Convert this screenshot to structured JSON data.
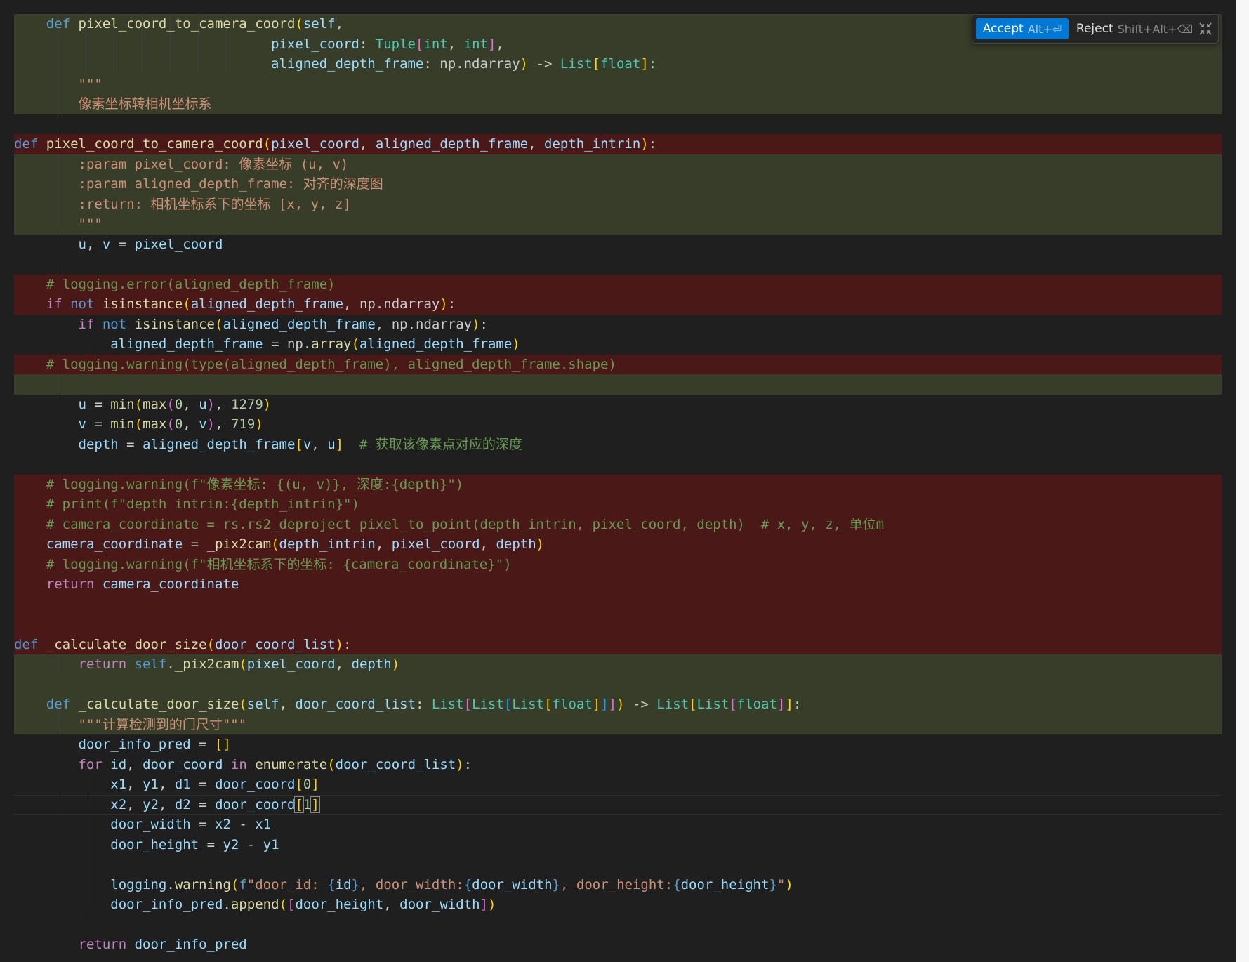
{
  "diff_widget": {
    "accept_label": "Accept",
    "accept_shortcut": "Alt+⏎",
    "reject_label": "Reject",
    "reject_shortcut": "Shift+Alt+⌫",
    "collapse_icon": "collapse-icon"
  },
  "lines": [
    {
      "bg": "added",
      "indent": 4,
      "guides": [
        4,
        8,
        12,
        16,
        20,
        24,
        28
      ],
      "tokens": [
        [
          "kw",
          "def "
        ],
        [
          "fn",
          "pixel_coord_to_camera_coord"
        ],
        [
          "br1",
          "("
        ],
        [
          "var",
          "self"
        ],
        [
          "plain",
          ","
        ]
      ]
    },
    {
      "bg": "added",
      "indent": 32,
      "guides": [
        4,
        8,
        12,
        16,
        20,
        24,
        28
      ],
      "tokens": [
        [
          "var",
          "pixel_coord"
        ],
        [
          "plain",
          ": "
        ],
        [
          "cls",
          "Tuple"
        ],
        [
          "br2",
          "["
        ],
        [
          "cls",
          "int"
        ],
        [
          "plain",
          ", "
        ],
        [
          "cls",
          "int"
        ],
        [
          "br2",
          "]"
        ],
        [
          "plain",
          ","
        ]
      ]
    },
    {
      "bg": "added",
      "indent": 32,
      "guides": [
        4,
        8,
        12,
        16,
        20,
        24,
        28
      ],
      "tokens": [
        [
          "var",
          "aligned_depth_frame"
        ],
        [
          "plain",
          ": "
        ],
        [
          "plain",
          "np.ndarray"
        ],
        [
          "br1",
          ")"
        ],
        [
          "plain",
          " -> "
        ],
        [
          "cls",
          "List"
        ],
        [
          "br1",
          "["
        ],
        [
          "cls",
          "float"
        ],
        [
          "br1",
          "]"
        ],
        [
          "plain",
          ":"
        ]
      ]
    },
    {
      "bg": "added",
      "indent": 8,
      "guides": [
        4
      ],
      "tokens": [
        [
          "str",
          "\"\"\""
        ]
      ]
    },
    {
      "bg": "added",
      "indent": 8,
      "guides": [
        4
      ],
      "tokens": [
        [
          "str",
          "像素坐标转相机坐标系"
        ]
      ]
    },
    {
      "bg": "none",
      "indent": 0,
      "guides": [
        4
      ],
      "tokens": []
    },
    {
      "bg": "removed",
      "indent": 0,
      "guides": [],
      "tokens": [
        [
          "kw",
          "def "
        ],
        [
          "fn",
          "pixel_coord_to_camera_coord"
        ],
        [
          "br1",
          "("
        ],
        [
          "var",
          "pixel_coord"
        ],
        [
          "plain",
          ", "
        ],
        [
          "var",
          "aligned_depth_frame"
        ],
        [
          "plain",
          ", "
        ],
        [
          "var",
          "depth_intrin"
        ],
        [
          "br1",
          ")"
        ],
        [
          "plain",
          ":"
        ]
      ]
    },
    {
      "bg": "added",
      "indent": 8,
      "guides": [
        4
      ],
      "tokens": [
        [
          "str",
          ":param pixel_coord: 像素坐标 (u, v)"
        ]
      ]
    },
    {
      "bg": "added",
      "indent": 8,
      "guides": [
        4
      ],
      "tokens": [
        [
          "str",
          ":param aligned_depth_frame: 对齐的深度图"
        ]
      ]
    },
    {
      "bg": "added",
      "indent": 8,
      "guides": [
        4
      ],
      "tokens": [
        [
          "str",
          ":return: 相机坐标系下的坐标 [x, y, z]"
        ]
      ]
    },
    {
      "bg": "added",
      "indent": 8,
      "guides": [
        4
      ],
      "tokens": [
        [
          "str",
          "\"\"\""
        ]
      ]
    },
    {
      "bg": "none",
      "indent": 8,
      "guides": [
        4
      ],
      "tokens": [
        [
          "var",
          "u"
        ],
        [
          "plain",
          ", "
        ],
        [
          "var",
          "v"
        ],
        [
          "plain",
          " = "
        ],
        [
          "var",
          "pixel_coord"
        ]
      ]
    },
    {
      "bg": "none",
      "indent": 0,
      "guides": [
        4
      ],
      "tokens": []
    },
    {
      "bg": "removed",
      "indent": 4,
      "guides": [],
      "tokens": [
        [
          "cm",
          "# logging.error(aligned_depth_frame)"
        ]
      ]
    },
    {
      "bg": "removed",
      "indent": 4,
      "guides": [],
      "tokens": [
        [
          "ctl",
          "if "
        ],
        [
          "kw",
          "not "
        ],
        [
          "fn",
          "isinstance"
        ],
        [
          "br1",
          "("
        ],
        [
          "var",
          "aligned_depth_frame"
        ],
        [
          "plain",
          ", "
        ],
        [
          "plain",
          "np.ndarray"
        ],
        [
          "br1",
          ")"
        ],
        [
          "plain",
          ":"
        ]
      ]
    },
    {
      "bg": "none",
      "indent": 8,
      "guides": [
        4
      ],
      "tokens": [
        [
          "ctl",
          "if "
        ],
        [
          "kw",
          "not "
        ],
        [
          "fn",
          "isinstance"
        ],
        [
          "br1",
          "("
        ],
        [
          "var",
          "aligned_depth_frame"
        ],
        [
          "plain",
          ", "
        ],
        [
          "plain",
          "np.ndarray"
        ],
        [
          "br1",
          ")"
        ],
        [
          "plain",
          ":"
        ]
      ]
    },
    {
      "bg": "none",
      "indent": 12,
      "guides": [
        4,
        8
      ],
      "tokens": [
        [
          "var",
          "aligned_depth_frame"
        ],
        [
          "plain",
          " = "
        ],
        [
          "plain",
          "np."
        ],
        [
          "fn",
          "array"
        ],
        [
          "br1",
          "("
        ],
        [
          "var",
          "aligned_depth_frame"
        ],
        [
          "br1",
          ")"
        ]
      ]
    },
    {
      "bg": "removed",
      "indent": 4,
      "guides": [],
      "tokens": [
        [
          "cm",
          "# logging.warning(type(aligned_depth_frame), aligned_depth_frame.shape)"
        ]
      ]
    },
    {
      "bg": "added",
      "indent": 0,
      "guides": [
        4
      ],
      "tokens": []
    },
    {
      "bg": "none",
      "indent": 8,
      "guides": [
        4
      ],
      "tokens": [
        [
          "var",
          "u"
        ],
        [
          "plain",
          " = "
        ],
        [
          "fn",
          "min"
        ],
        [
          "br1",
          "("
        ],
        [
          "fn",
          "max"
        ],
        [
          "br2",
          "("
        ],
        [
          "num",
          "0"
        ],
        [
          "plain",
          ", "
        ],
        [
          "var",
          "u"
        ],
        [
          "br2",
          ")"
        ],
        [
          "plain",
          ", "
        ],
        [
          "num",
          "1279"
        ],
        [
          "br1",
          ")"
        ]
      ]
    },
    {
      "bg": "none",
      "indent": 8,
      "guides": [
        4
      ],
      "tokens": [
        [
          "var",
          "v"
        ],
        [
          "plain",
          " = "
        ],
        [
          "fn",
          "min"
        ],
        [
          "br1",
          "("
        ],
        [
          "fn",
          "max"
        ],
        [
          "br2",
          "("
        ],
        [
          "num",
          "0"
        ],
        [
          "plain",
          ", "
        ],
        [
          "var",
          "v"
        ],
        [
          "br2",
          ")"
        ],
        [
          "plain",
          ", "
        ],
        [
          "num",
          "719"
        ],
        [
          "br1",
          ")"
        ]
      ]
    },
    {
      "bg": "none",
      "indent": 8,
      "guides": [
        4
      ],
      "tokens": [
        [
          "var",
          "depth"
        ],
        [
          "plain",
          " = "
        ],
        [
          "var",
          "aligned_depth_frame"
        ],
        [
          "br1",
          "["
        ],
        [
          "var",
          "v"
        ],
        [
          "plain",
          ", "
        ],
        [
          "var",
          "u"
        ],
        [
          "br1",
          "]"
        ],
        [
          "plain",
          "  "
        ],
        [
          "cm",
          "# 获取该像素点对应的深度"
        ]
      ]
    },
    {
      "bg": "none",
      "indent": 0,
      "guides": [
        4
      ],
      "tokens": []
    },
    {
      "bg": "removed",
      "indent": 4,
      "guides": [],
      "tokens": [
        [
          "cm",
          "# logging.warning(f\"像素坐标: {(u, v)}, 深度:{depth}\")"
        ]
      ]
    },
    {
      "bg": "removed",
      "indent": 4,
      "guides": [],
      "tokens": [
        [
          "cm",
          "# print(f\"depth intrin:{depth_intrin}\")"
        ]
      ]
    },
    {
      "bg": "removed",
      "indent": 4,
      "guides": [],
      "tokens": [
        [
          "cm",
          "# camera_coordinate = rs.rs2_deproject_pixel_to_point(depth_intrin, pixel_coord, depth)  # x, y, z, 单位m"
        ]
      ]
    },
    {
      "bg": "removed",
      "indent": 4,
      "guides": [],
      "tokens": [
        [
          "var",
          "camera_coordinate"
        ],
        [
          "plain",
          " = "
        ],
        [
          "fn",
          "_pix2cam"
        ],
        [
          "br1",
          "("
        ],
        [
          "var",
          "depth_intrin"
        ],
        [
          "plain",
          ", "
        ],
        [
          "var",
          "pixel_coord"
        ],
        [
          "plain",
          ", "
        ],
        [
          "var",
          "depth"
        ],
        [
          "br1",
          ")"
        ]
      ]
    },
    {
      "bg": "removed",
      "indent": 4,
      "guides": [],
      "tokens": [
        [
          "cm",
          "# logging.warning(f\"相机坐标系下的坐标: {camera_coordinate}\")"
        ]
      ]
    },
    {
      "bg": "removed",
      "indent": 4,
      "guides": [],
      "tokens": [
        [
          "ctl",
          "return "
        ],
        [
          "var",
          "camera_coordinate"
        ]
      ]
    },
    {
      "bg": "removed",
      "indent": 0,
      "guides": [],
      "tokens": []
    },
    {
      "bg": "removed",
      "indent": 0,
      "guides": [],
      "tokens": []
    },
    {
      "bg": "removed",
      "indent": 0,
      "guides": [],
      "tokens": [
        [
          "kw",
          "def "
        ],
        [
          "fn",
          "_calculate_door_size"
        ],
        [
          "br1",
          "("
        ],
        [
          "var",
          "door_coord_list"
        ],
        [
          "br1",
          ")"
        ],
        [
          "plain",
          ":"
        ]
      ]
    },
    {
      "bg": "added",
      "indent": 8,
      "guides": [
        4
      ],
      "tokens": [
        [
          "ctl",
          "return "
        ],
        [
          "kw",
          "self"
        ],
        [
          "plain",
          "."
        ],
        [
          "fn",
          "_pix2cam"
        ],
        [
          "br1",
          "("
        ],
        [
          "var",
          "pixel_coord"
        ],
        [
          "plain",
          ", "
        ],
        [
          "var",
          "depth"
        ],
        [
          "br1",
          ")"
        ]
      ]
    },
    {
      "bg": "added",
      "indent": 0,
      "guides": [],
      "tokens": []
    },
    {
      "bg": "added",
      "indent": 4,
      "guides": [],
      "tokens": [
        [
          "kw",
          "def "
        ],
        [
          "fn",
          "_calculate_door_size"
        ],
        [
          "br1",
          "("
        ],
        [
          "var",
          "self"
        ],
        [
          "plain",
          ", "
        ],
        [
          "var",
          "door_coord_list"
        ],
        [
          "plain",
          ": "
        ],
        [
          "cls",
          "List"
        ],
        [
          "br2",
          "["
        ],
        [
          "cls",
          "List"
        ],
        [
          "br3",
          "["
        ],
        [
          "cls",
          "List"
        ],
        [
          "br1",
          "["
        ],
        [
          "cls",
          "float"
        ],
        [
          "br1",
          "]"
        ],
        [
          "br3",
          "]"
        ],
        [
          "br2",
          "]"
        ],
        [
          "br1",
          ")"
        ],
        [
          "plain",
          " -> "
        ],
        [
          "cls",
          "List"
        ],
        [
          "br1",
          "["
        ],
        [
          "cls",
          "List"
        ],
        [
          "br2",
          "["
        ],
        [
          "cls",
          "float"
        ],
        [
          "br2",
          "]"
        ],
        [
          "br1",
          "]"
        ],
        [
          "plain",
          ":"
        ]
      ]
    },
    {
      "bg": "added",
      "indent": 8,
      "guides": [
        4
      ],
      "tokens": [
        [
          "str",
          "\"\"\"计算检测到的门尺寸\"\"\""
        ]
      ]
    },
    {
      "bg": "none",
      "indent": 8,
      "guides": [
        4
      ],
      "tokens": [
        [
          "var",
          "door_info_pred"
        ],
        [
          "plain",
          " = "
        ],
        [
          "br1",
          "[]"
        ]
      ]
    },
    {
      "bg": "none",
      "indent": 8,
      "guides": [
        4
      ],
      "tokens": [
        [
          "ctl",
          "for "
        ],
        [
          "var",
          "id"
        ],
        [
          "plain",
          ", "
        ],
        [
          "var",
          "door_coord"
        ],
        [
          "ctl",
          " in "
        ],
        [
          "fn",
          "enumerate"
        ],
        [
          "br1",
          "("
        ],
        [
          "var",
          "door_coord_list"
        ],
        [
          "br1",
          ")"
        ],
        [
          "plain",
          ":"
        ]
      ]
    },
    {
      "bg": "none",
      "indent": 12,
      "guides": [
        4,
        8
      ],
      "tokens": [
        [
          "var",
          "x1"
        ],
        [
          "plain",
          ", "
        ],
        [
          "var",
          "y1"
        ],
        [
          "plain",
          ", "
        ],
        [
          "var",
          "d1"
        ],
        [
          "plain",
          " = "
        ],
        [
          "var",
          "door_coord"
        ],
        [
          "br1",
          "["
        ],
        [
          "num",
          "0"
        ],
        [
          "br1",
          "]"
        ]
      ]
    },
    {
      "bg": "none",
      "current": true,
      "indent": 12,
      "guides": [
        4,
        8
      ],
      "tokens": [
        [
          "var",
          "x2"
        ],
        [
          "plain",
          ", "
        ],
        [
          "var",
          "y2"
        ],
        [
          "plain",
          ", "
        ],
        [
          "var",
          "d2"
        ],
        [
          "plain",
          " = "
        ],
        [
          "var",
          "door_coord"
        ],
        [
          "br1box",
          "["
        ],
        [
          "num",
          "1"
        ],
        [
          "br1box",
          "]"
        ]
      ]
    },
    {
      "bg": "none",
      "indent": 12,
      "guides": [
        4,
        8
      ],
      "tokens": [
        [
          "var",
          "door_width"
        ],
        [
          "plain",
          " = "
        ],
        [
          "var",
          "x2"
        ],
        [
          "plain",
          " - "
        ],
        [
          "var",
          "x1"
        ]
      ]
    },
    {
      "bg": "none",
      "indent": 12,
      "guides": [
        4,
        8
      ],
      "tokens": [
        [
          "var",
          "door_height"
        ],
        [
          "plain",
          " = "
        ],
        [
          "var",
          "y2"
        ],
        [
          "plain",
          " - "
        ],
        [
          "var",
          "y1"
        ]
      ]
    },
    {
      "bg": "none",
      "indent": 0,
      "guides": [
        4,
        8
      ],
      "tokens": []
    },
    {
      "bg": "none",
      "indent": 12,
      "guides": [
        4,
        8
      ],
      "tokens": [
        [
          "var",
          "logging"
        ],
        [
          "plain",
          "."
        ],
        [
          "fn",
          "warning"
        ],
        [
          "br1",
          "("
        ],
        [
          "kw",
          "f"
        ],
        [
          "str",
          "\"door_id: "
        ],
        [
          "kw",
          "{"
        ],
        [
          "var",
          "id"
        ],
        [
          "kw",
          "}"
        ],
        [
          "str",
          ", door_width:"
        ],
        [
          "kw",
          "{"
        ],
        [
          "var",
          "door_width"
        ],
        [
          "kw",
          "}"
        ],
        [
          "str",
          ", door_height:"
        ],
        [
          "kw",
          "{"
        ],
        [
          "var",
          "door_height"
        ],
        [
          "kw",
          "}"
        ],
        [
          "str",
          "\""
        ],
        [
          "br1",
          ")"
        ]
      ]
    },
    {
      "bg": "none",
      "indent": 12,
      "guides": [
        4,
        8
      ],
      "tokens": [
        [
          "var",
          "door_info_pred"
        ],
        [
          "plain",
          "."
        ],
        [
          "fn",
          "append"
        ],
        [
          "br1",
          "("
        ],
        [
          "br2",
          "["
        ],
        [
          "var",
          "door_height"
        ],
        [
          "plain",
          ", "
        ],
        [
          "var",
          "door_width"
        ],
        [
          "br2",
          "]"
        ],
        [
          "br1",
          ")"
        ]
      ]
    },
    {
      "bg": "none",
      "indent": 0,
      "guides": [
        4
      ],
      "tokens": []
    },
    {
      "bg": "none",
      "indent": 8,
      "guides": [
        4
      ],
      "tokens": [
        [
          "ctl",
          "return "
        ],
        [
          "var",
          "door_info_pred"
        ]
      ]
    }
  ]
}
